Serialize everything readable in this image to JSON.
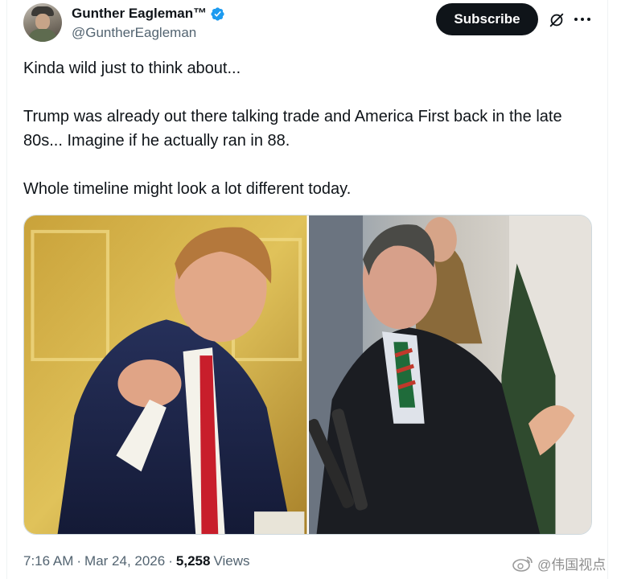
{
  "author": {
    "display_name": "Gunther Eagleman™",
    "handle": "@GuntherEagleman",
    "verified": true
  },
  "actions": {
    "subscribe_label": "Subscribe"
  },
  "tweet": {
    "paragraphs": [
      "Kinda wild just to think about...",
      "Trump was already out there talking trade and America First back in the late 80s... Imagine if he actually ran in 88.",
      "Whole timeline might look a lot different today."
    ]
  },
  "media": {
    "photos": [
      {
        "depicts": "man-in-pinstripe-suit-red-tie-pointing"
      },
      {
        "depicts": "man-at-microphones-gesturing"
      }
    ]
  },
  "meta": {
    "time": "7:16 AM",
    "separator": "·",
    "date": "Mar 24, 2026",
    "views_count": "5,258",
    "views_label": "Views"
  },
  "watermark": {
    "text": "@伟国视点"
  },
  "colors": {
    "text_primary": "#0f1419",
    "text_secondary": "#536471",
    "verified_blue": "#1d9bf0",
    "button_bg": "#0f1419"
  }
}
